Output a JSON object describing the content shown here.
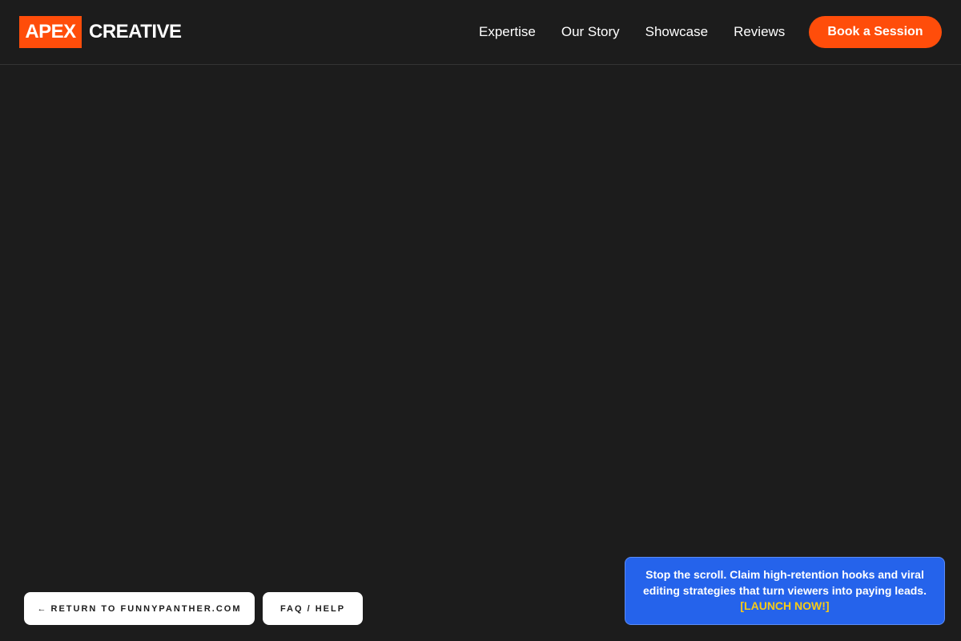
{
  "header": {
    "logo_box": "APEX",
    "logo_text": "CREATIVE",
    "nav": [
      "Expertise",
      "Our Story",
      "Showcase",
      "Reviews"
    ],
    "cta_label": "Book a Session"
  },
  "footer_pills": {
    "return_arrow": "←",
    "return_label": "RETURN TO FUNNYPANTHER.COM",
    "faq_label": "FAQ / HELP"
  },
  "promo": {
    "text": "Stop the scroll. Claim high-retention hooks and viral editing strategies that turn viewers into paying leads.",
    "link_label": "[LAUNCH NOW!]"
  },
  "colors": {
    "background": "#1c1c1c",
    "accent": "#ff4d0a",
    "promo_blue": "#2563eb",
    "promo_link": "#facc15"
  }
}
